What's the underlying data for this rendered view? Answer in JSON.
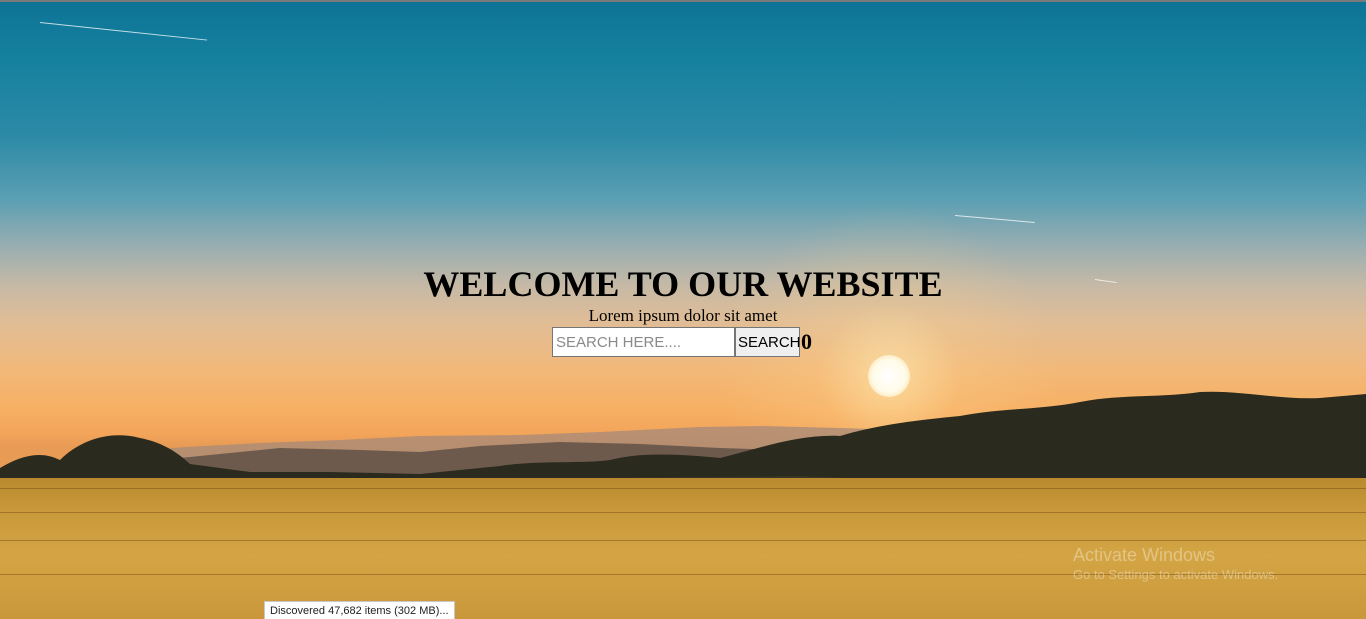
{
  "hero": {
    "title": "WELCOME TO OUR WEBSITE",
    "subtitle": "Lorem ipsum dolor sit amet"
  },
  "search": {
    "placeholder": "SEARCH HERE....",
    "value": "",
    "button_label": "SEARCH",
    "result_count": "0"
  },
  "status_bar": {
    "text": "Discovered 47,682 items (302 MB)..."
  },
  "watermark": {
    "title": "Activate Windows",
    "subtitle": "Go to Settings to activate Windows."
  },
  "background": {
    "description_icon": "sunset-field-photo"
  }
}
